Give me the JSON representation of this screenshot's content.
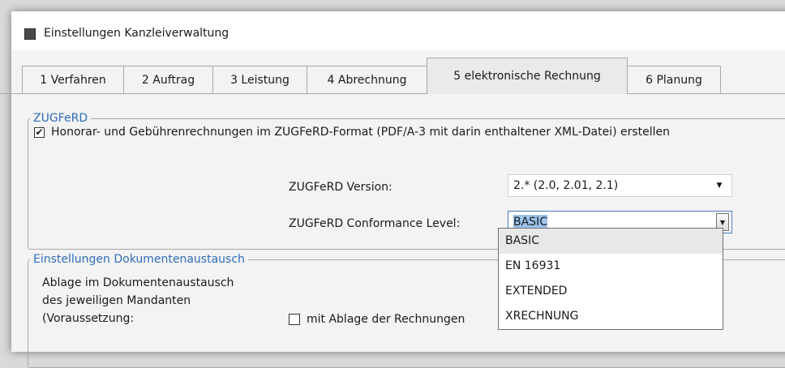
{
  "window": {
    "title": "Einstellungen Kanzleiverwaltung"
  },
  "tabs": [
    {
      "label": "1 Verfahren"
    },
    {
      "label": "2 Auftrag"
    },
    {
      "label": "3 Leistung"
    },
    {
      "label": "4 Abrechnung"
    },
    {
      "label": "5 elektronische Rechnung",
      "active": true
    },
    {
      "label": "6 Planung"
    }
  ],
  "zugferd": {
    "legend": "ZUGFeRD",
    "checkbox_label": "Honorar- und Gebührenrechnungen im ZUGFeRD-Format (PDF/A-3 mit darin enthaltener XML-Datei) erstellen",
    "checkbox_checked": true,
    "version_label": "ZUGFeRD Version:",
    "version_value": "2.* (2.0, 2.01, 2.1)",
    "conformance_label": "ZUGFeRD Conformance Level:",
    "conformance_value": "BASIC",
    "conformance_options": [
      "BASIC",
      "EN 16931",
      "EXTENDED",
      "XRECHNUNG"
    ]
  },
  "docs": {
    "legend": "Einstellungen Dokumentenaustausch",
    "description_line1": "Ablage im Dokumentenaustausch",
    "description_line2": "des jeweiligen Mandanten",
    "description_line3": "(Voraussetzung:",
    "checkbox_label": "mit Ablage der Rechnungen",
    "checkbox_checked": false
  },
  "colors": {
    "accent": "#2d6dba",
    "selection": "#9cc3ec"
  }
}
